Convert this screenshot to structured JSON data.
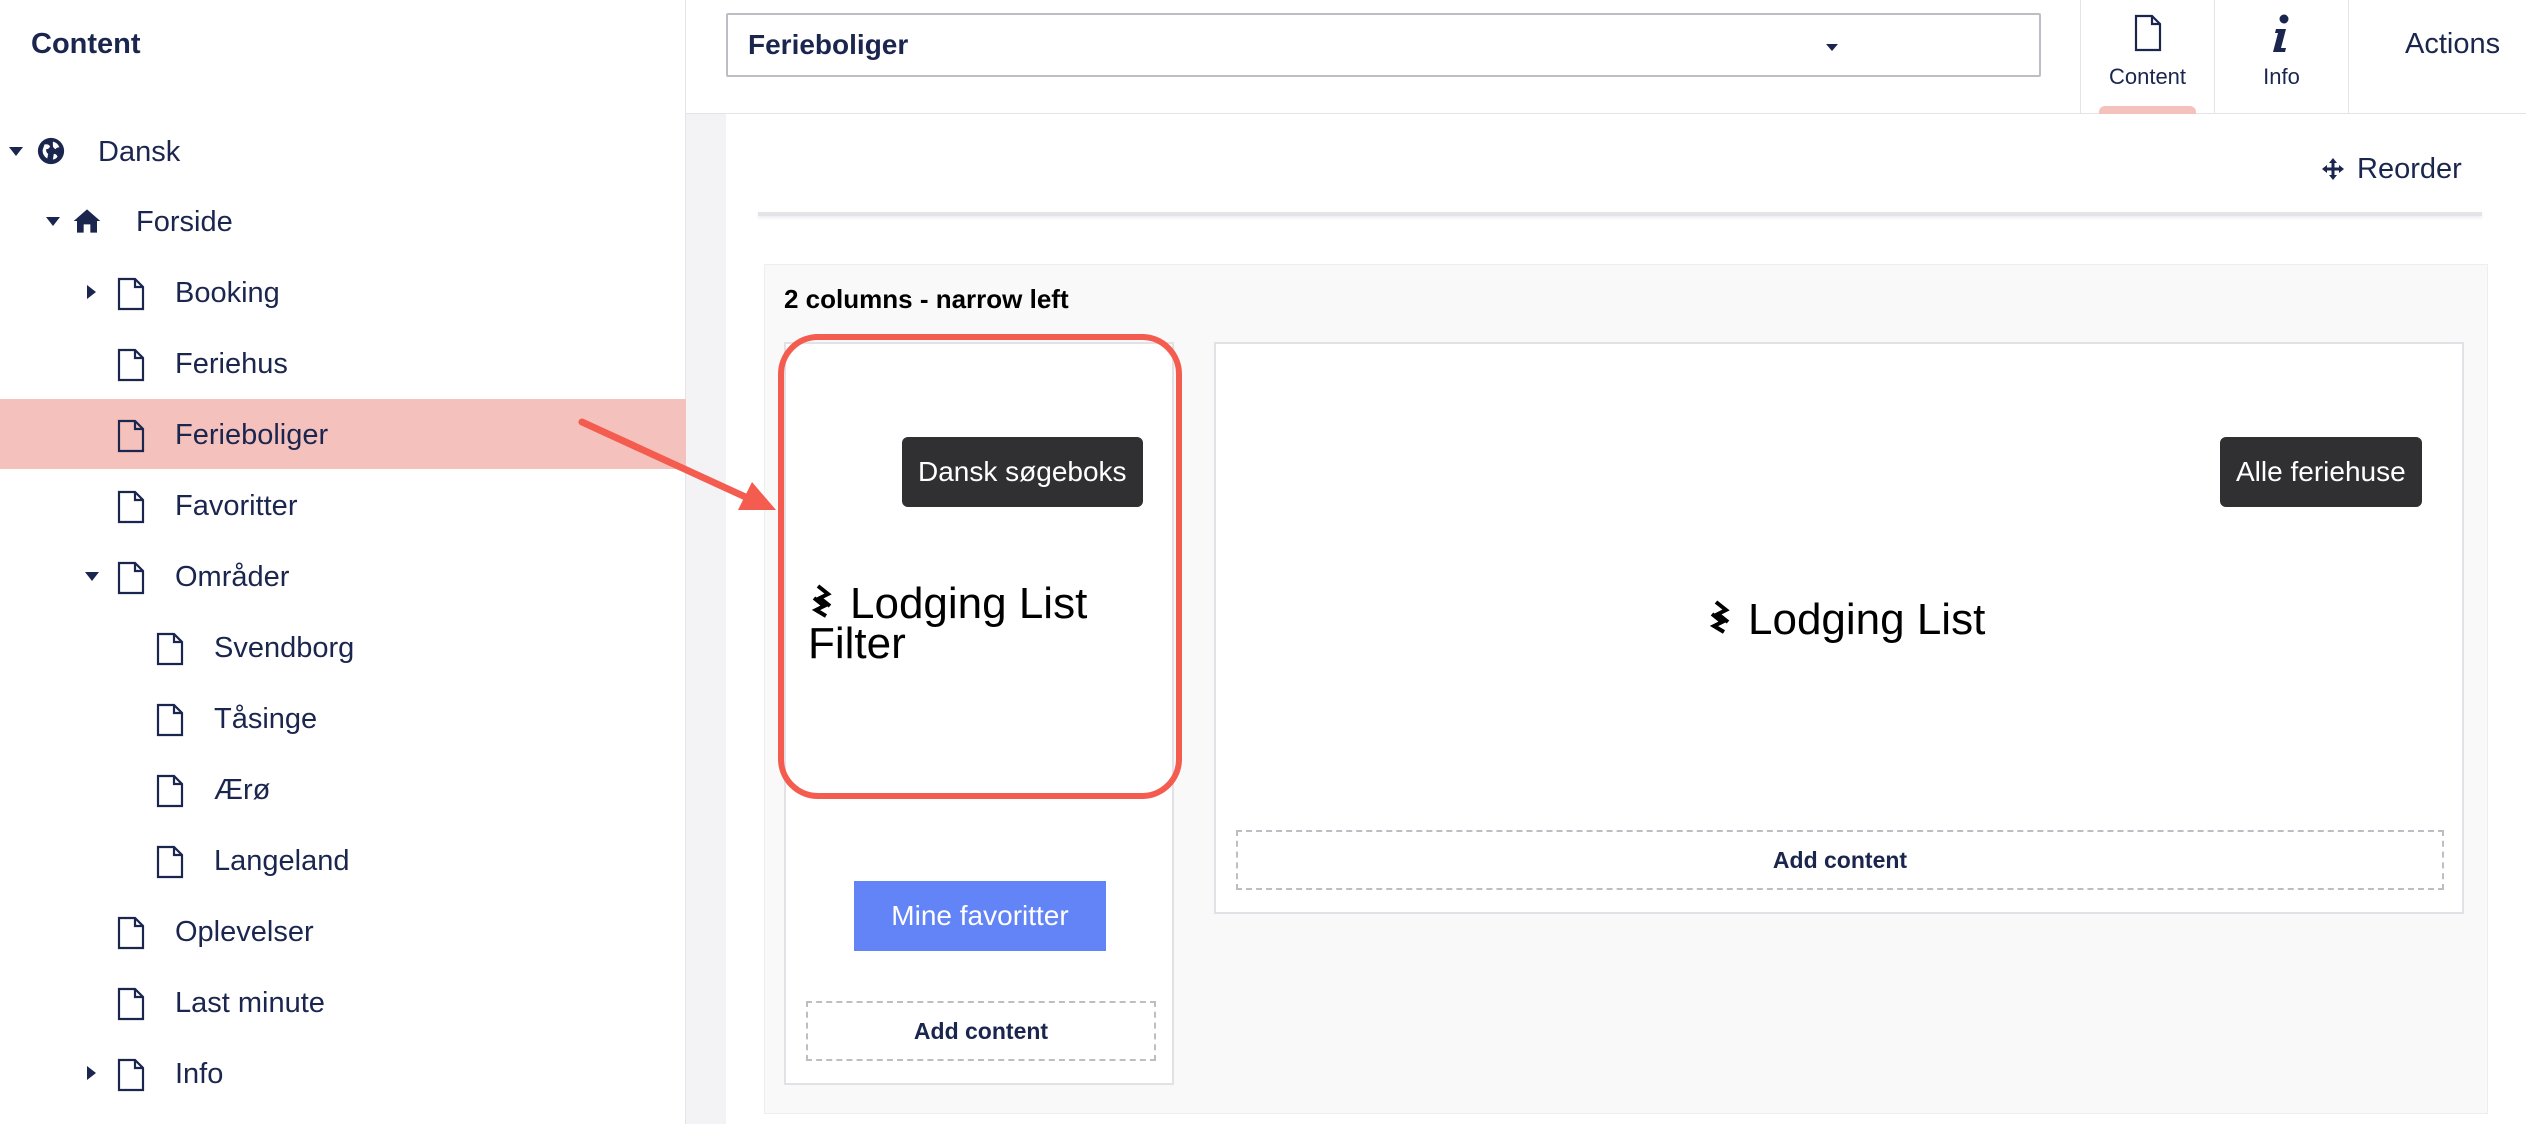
{
  "sidebar": {
    "title": "Content",
    "items": [
      {
        "label": "Dansk",
        "icon": "globe-icon",
        "caret": "down"
      },
      {
        "label": "Forside",
        "icon": "home-icon",
        "caret": "down"
      },
      {
        "label": "Booking",
        "icon": "document-icon",
        "caret": "right"
      },
      {
        "label": "Feriehus",
        "icon": "document-icon",
        "caret": ""
      },
      {
        "label": "Ferieboliger",
        "icon": "document-icon",
        "caret": "",
        "selected": true
      },
      {
        "label": "Favoritter",
        "icon": "document-icon",
        "caret": ""
      },
      {
        "label": "Områder",
        "icon": "document-icon",
        "caret": "down"
      },
      {
        "label": "Svendborg",
        "icon": "document-icon",
        "caret": ""
      },
      {
        "label": "Tåsinge",
        "icon": "document-icon",
        "caret": ""
      },
      {
        "label": "Ærø",
        "icon": "document-icon",
        "caret": ""
      },
      {
        "label": "Langeland",
        "icon": "document-icon",
        "caret": ""
      },
      {
        "label": "Oplevelser",
        "icon": "document-icon",
        "caret": ""
      },
      {
        "label": "Last minute",
        "icon": "document-icon",
        "caret": ""
      },
      {
        "label": "Info",
        "icon": "document-icon",
        "caret": "right"
      }
    ]
  },
  "header": {
    "name_value": "Ferieboliger",
    "tabs": [
      {
        "label": "Content",
        "icon": "document-icon",
        "active": true
      },
      {
        "label": "Info",
        "icon": "info-icon",
        "active": false
      }
    ],
    "actions_label": "Actions"
  },
  "editor": {
    "reorder_label": "Reorder",
    "layout_title": "2 columns - narrow left",
    "left_column": {
      "block_label": "Dansk søgeboks",
      "block_title_line1": "Lodging List",
      "block_title_line2": "Filter",
      "button_label": "Mine favoritter",
      "add_content_label": "Add content"
    },
    "right_column": {
      "block_label": "Alle feriehuse",
      "block_title": "Lodging List",
      "add_content_label": "Add content"
    }
  },
  "colors": {
    "selected_bg": "#f5c1bc",
    "highlight": "#f35c4e",
    "primary_button": "#6284f6",
    "text": "#1b264f"
  }
}
